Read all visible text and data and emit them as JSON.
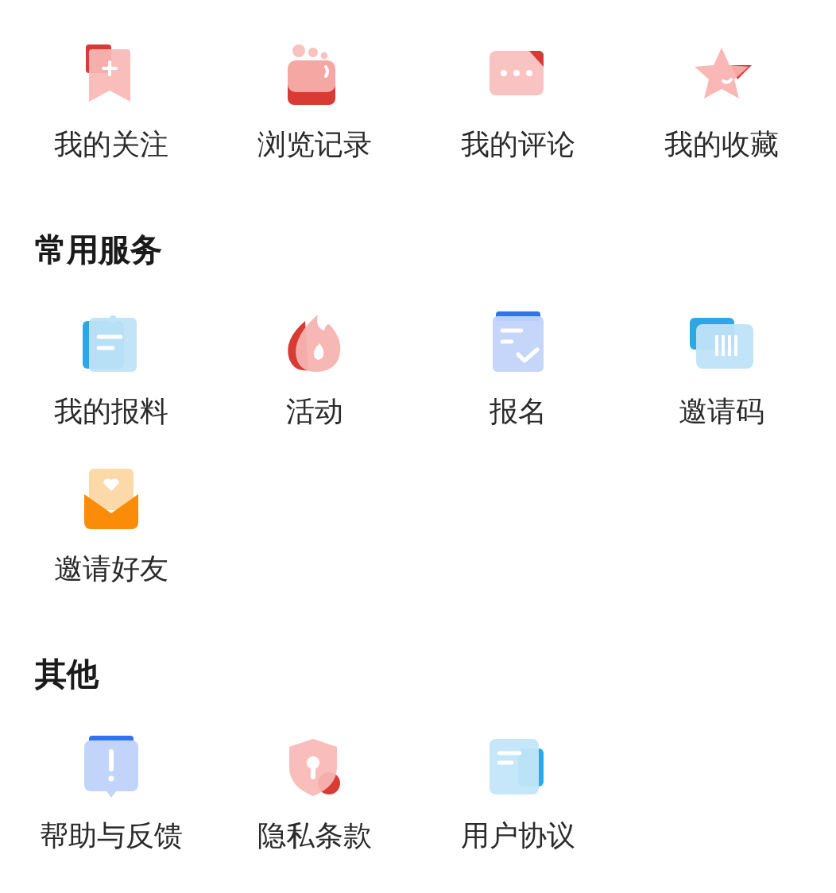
{
  "sections": [
    {
      "items": [
        {
          "label": "我的关注"
        },
        {
          "label": "浏览记录"
        },
        {
          "label": "我的评论"
        },
        {
          "label": "我的收藏"
        }
      ]
    },
    {
      "title": "常用服务",
      "items": [
        {
          "label": "我的报料"
        },
        {
          "label": "活动"
        },
        {
          "label": "报名"
        },
        {
          "label": "邀请码"
        },
        {
          "label": "邀请好友"
        }
      ]
    },
    {
      "title": "其他",
      "items": [
        {
          "label": "帮助与反馈"
        },
        {
          "label": "隐私条款"
        },
        {
          "label": "用户协议"
        }
      ]
    }
  ]
}
